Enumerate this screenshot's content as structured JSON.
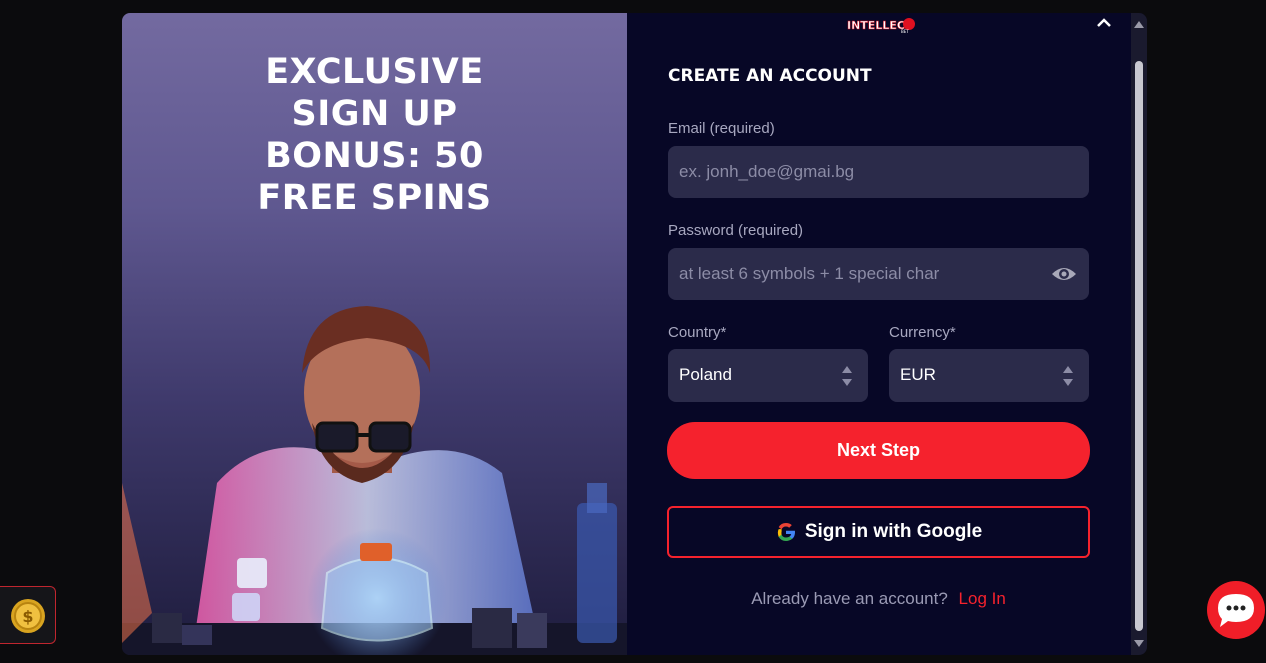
{
  "promo": {
    "title": "EXCLUSIVE SIGN UP BONUS: 50 FREE SPINS"
  },
  "logo": {
    "text": "INTELLECT",
    "subtext": "BET"
  },
  "form": {
    "title": "CREATE AN ACCOUNT",
    "email": {
      "label": "Email (required)",
      "placeholder": "ex. jonh_doe@gmai.bg"
    },
    "password": {
      "label": "Password (required)",
      "placeholder": "at least 6 symbols + 1 special char"
    },
    "country": {
      "label": "Country*",
      "value": "Poland"
    },
    "currency": {
      "label": "Currency*",
      "value": "EUR"
    },
    "next_button": "Next Step",
    "google_button": "Sign in with Google",
    "login_prompt": "Already have an account?",
    "login_link": "Log In"
  },
  "icons": {
    "close": "chevron-up-icon",
    "eye": "eye-icon",
    "google": "google-icon",
    "coin": "coin-icon",
    "chat": "chat-icon"
  },
  "colors": {
    "accent": "#f5222d",
    "panel_bg": "#070726",
    "field_bg": "#2b2b4a"
  }
}
